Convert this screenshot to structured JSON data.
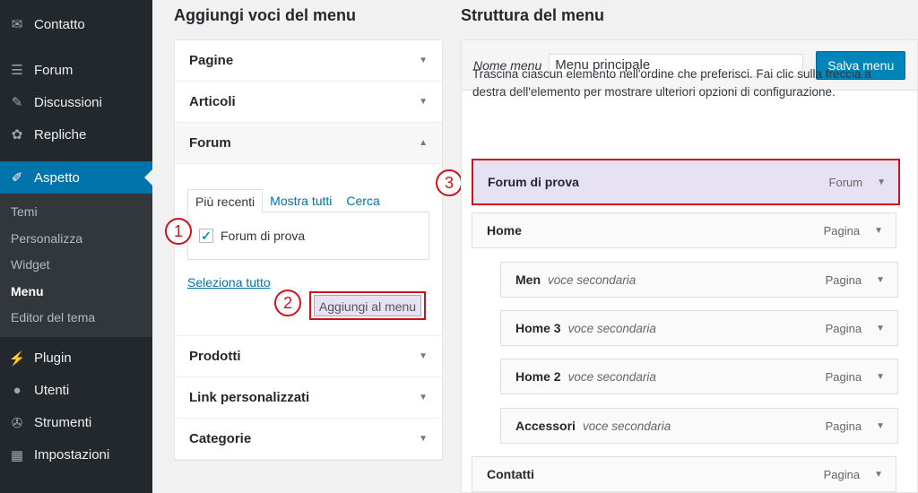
{
  "sidebar": {
    "contact": "Contatto",
    "forum": "Forum",
    "discussioni": "Discussioni",
    "repliche": "Repliche",
    "aspetto": "Aspetto",
    "submenu": [
      "Temi",
      "Personalizza",
      "Widget",
      "Menu",
      "Editor del tema"
    ],
    "plugin": "Plugin",
    "utenti": "Utenti",
    "strumenti": "Strumenti",
    "impostazioni": "Impostazioni"
  },
  "left": {
    "title": "Aggiungi voci del menu",
    "pagine": "Pagine",
    "articoli": "Articoli",
    "forum": "Forum",
    "tabs": [
      "Più recenti",
      "Mostra tutti",
      "Cerca"
    ],
    "checkbox_label": "Forum di prova",
    "select_all": "Seleziona tutto",
    "add_button": "Aggiungi al menu",
    "prodotti": "Prodotti",
    "link": "Link personalizzati",
    "categorie": "Categorie"
  },
  "markers": [
    "1",
    "2",
    "3"
  ],
  "right": {
    "title": "Struttura del menu",
    "name_label": "Nome menu",
    "name_value": "Menu principale",
    "save_button": "Salva menu",
    "instructions": "Trascina ciascun elemento nell'ordine che preferisci. Fai clic sulla freccia a destra dell'elemento per mostrare ulteriori opzioni di configurazione.",
    "items": [
      {
        "title": "Forum di prova",
        "sub": "",
        "type": "Forum"
      },
      {
        "title": "Home",
        "sub": "",
        "type": "Pagina"
      },
      {
        "title": "Men",
        "sub": "voce secondaria",
        "type": "Pagina"
      },
      {
        "title": "Home 3",
        "sub": "voce secondaria",
        "type": "Pagina"
      },
      {
        "title": "Home 2",
        "sub": "voce secondaria",
        "type": "Pagina"
      },
      {
        "title": "Accessori",
        "sub": "voce secondaria",
        "type": "Pagina"
      },
      {
        "title": "Contatti",
        "sub": "",
        "type": "Pagina"
      }
    ]
  },
  "colors": {
    "accent": "#0073aa",
    "highlight": "#d0101a",
    "sidebar": "#23282d"
  }
}
